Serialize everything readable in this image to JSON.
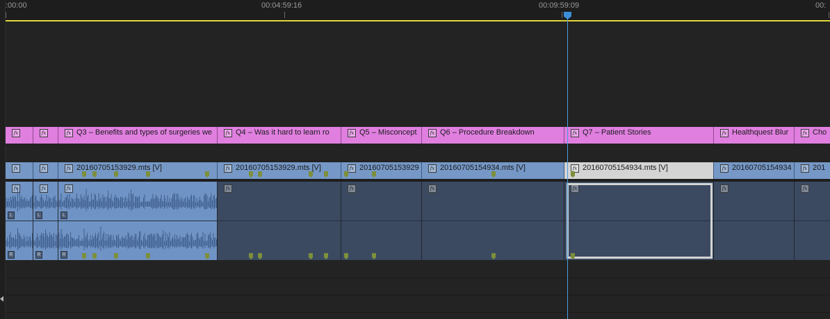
{
  "ruler": {
    "timecodes": [
      ":00:00",
      "00:04:59:16",
      "00:09:59:09",
      "00:"
    ]
  },
  "graphics_track": {
    "clips": [
      {
        "label": ""
      },
      {
        "label": ""
      },
      {
        "label": "Q3 – Benefits and types of surgeries we"
      },
      {
        "label": "Q4 – Was it hard to learn ro"
      },
      {
        "label": "Q5 – Misconcept"
      },
      {
        "label": "Q6 – Procedure Breakdown"
      },
      {
        "label": "Q7 – Patient Stories"
      },
      {
        "label": "Healthquest Blur"
      },
      {
        "label": "Cho"
      }
    ]
  },
  "video_track": {
    "clips": [
      {
        "label": ""
      },
      {
        "label": ""
      },
      {
        "label": "20160705153929.mts [V]"
      },
      {
        "label": "20160705153929.mts [V]"
      },
      {
        "label": "20160705153929"
      },
      {
        "label": "20160705154934.mts [V]"
      },
      {
        "label": "20160705154934.mts [V]"
      },
      {
        "label": "20160705154934"
      },
      {
        "label": "201"
      }
    ]
  },
  "audio_track": {
    "channel_left": "L",
    "channel_right": "R"
  },
  "fx_badge": "fx",
  "colors": {
    "graphics": "#e07fe0",
    "video": "#7598c6",
    "audio_filled": "#6f93c4",
    "audio_empty": "#3b4a61",
    "playhead": "#3a8fd8",
    "work_area": "#e4d83a",
    "marker": "#7d8f3a"
  },
  "icons": {
    "playhead": "playhead-icon",
    "marker": "marker-icon",
    "fx": "fx-badge-icon",
    "scroll": "scroll-left-icon"
  }
}
